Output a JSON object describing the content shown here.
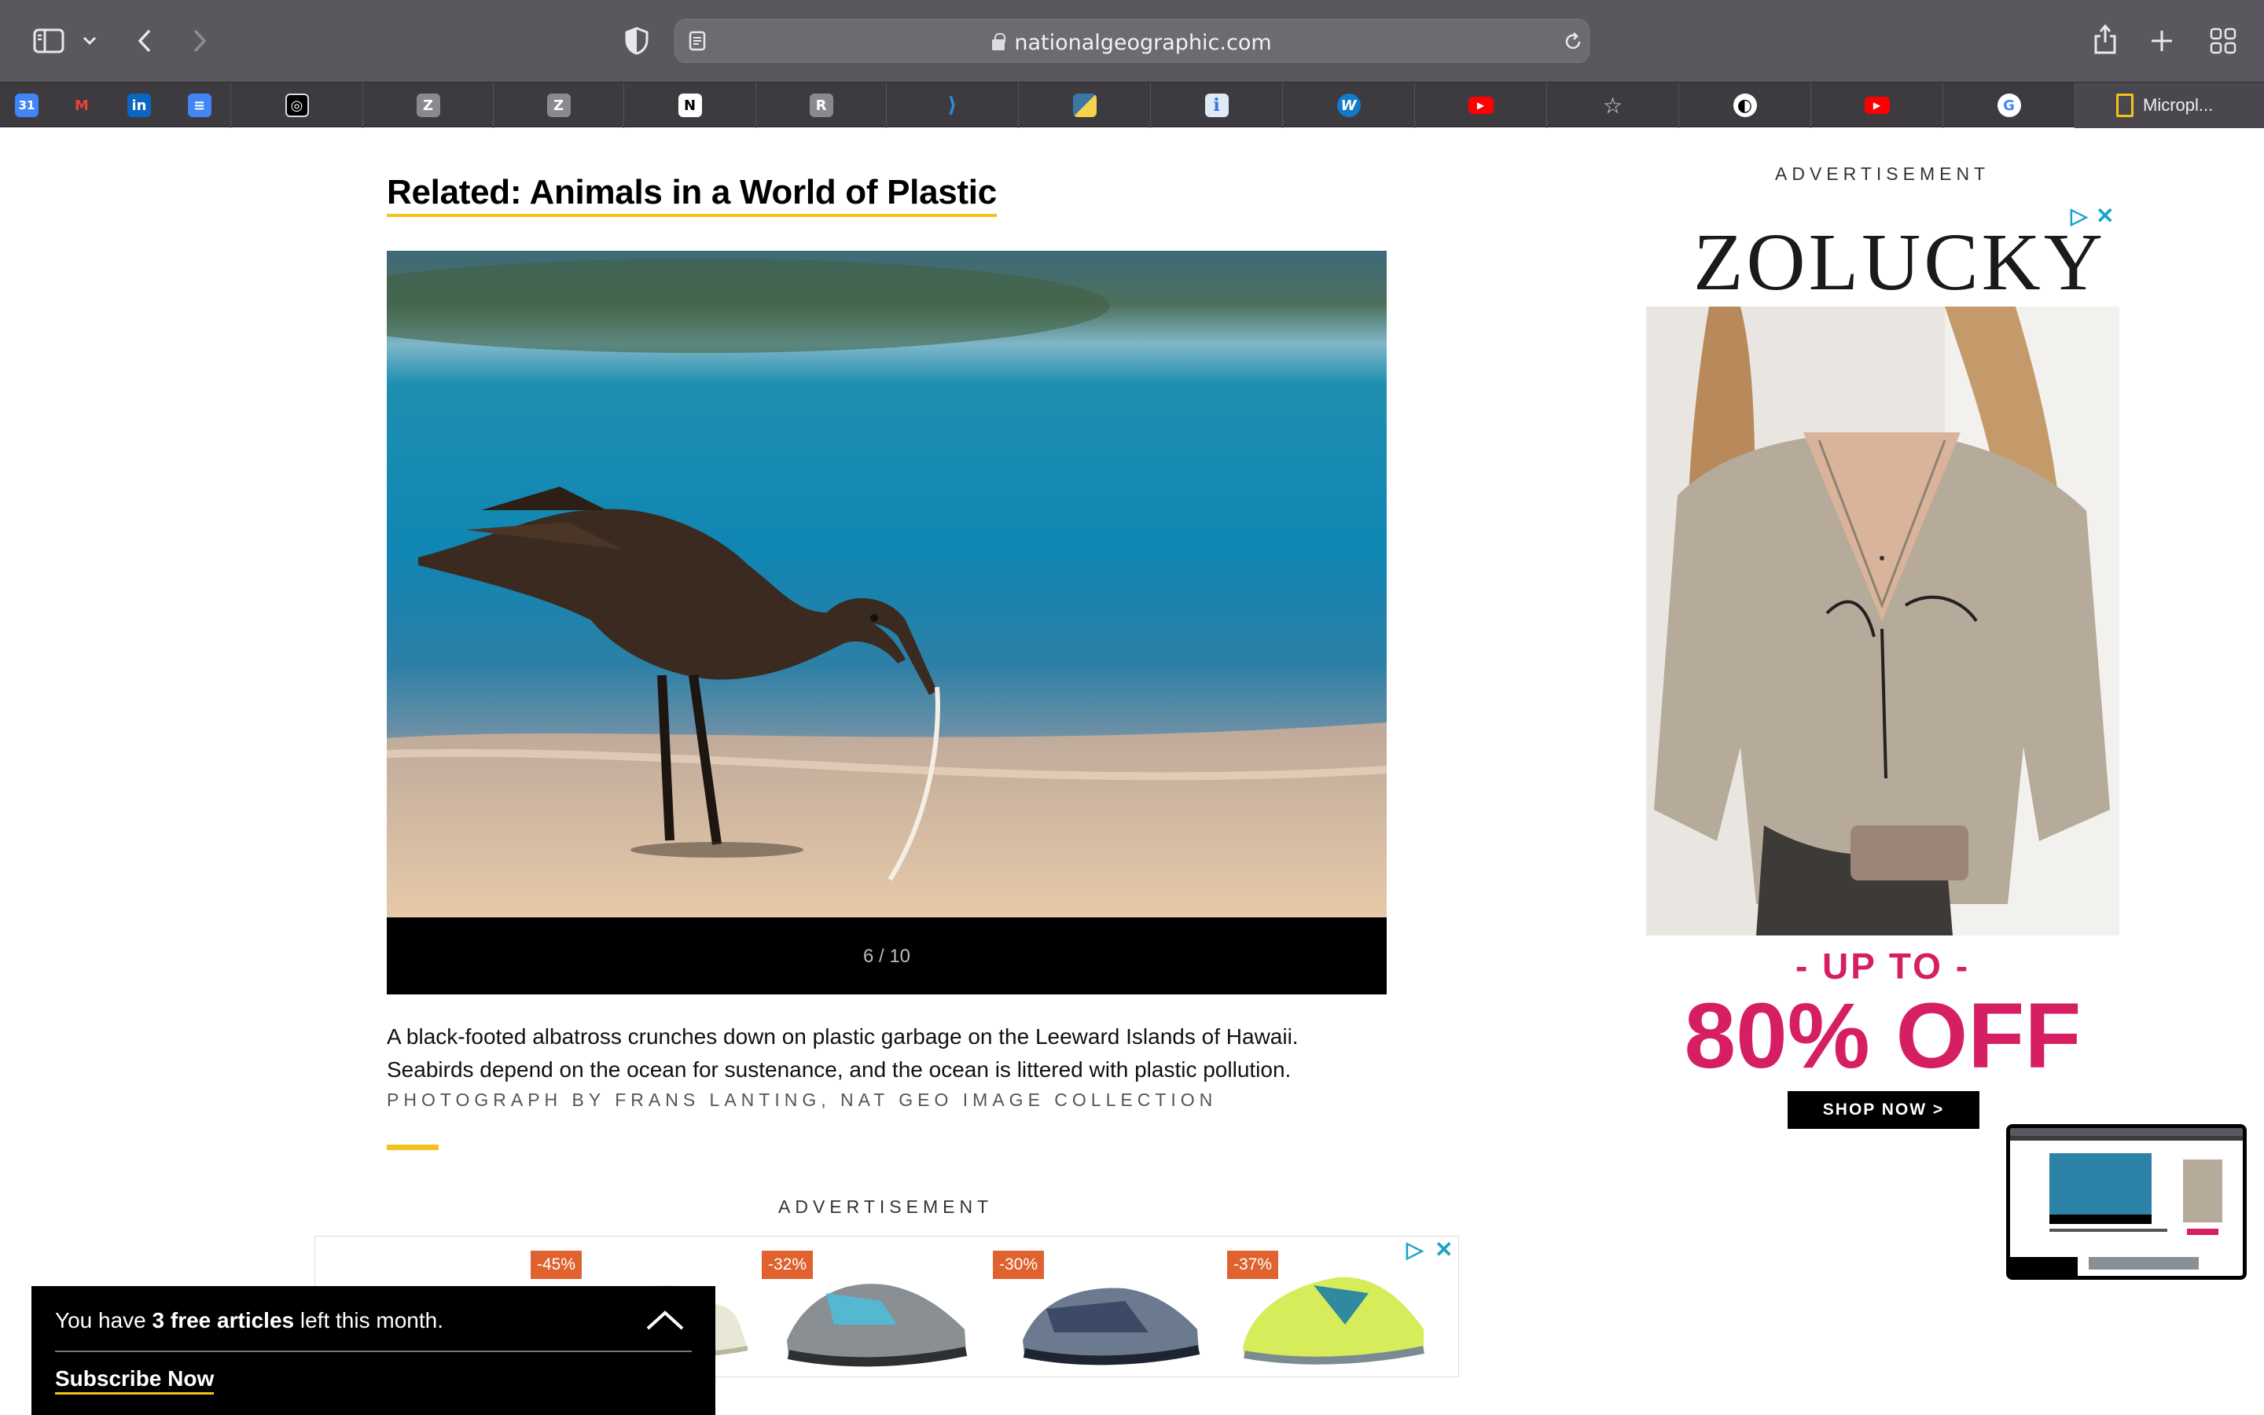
{
  "browser": {
    "url": "nationalgeographic.com",
    "favorites": [
      {
        "icon": "google-calendar-icon",
        "label": "31",
        "color": "#4285f4"
      },
      {
        "icon": "gmail-icon",
        "label": "M",
        "color": "#ea4335"
      },
      {
        "icon": "linkedin-icon",
        "label": "in",
        "color": "#0a66c2"
      },
      {
        "icon": "google-docs-icon",
        "label": "≡",
        "color": "#4285f4"
      },
      {
        "icon": "target-icon",
        "label": "◎",
        "color": "#000000"
      },
      {
        "icon": "zotero-icon",
        "label": "Z",
        "color": "#8a8a8e"
      },
      {
        "icon": "zotero-icon",
        "label": "Z",
        "color": "#8a8a8e"
      },
      {
        "icon": "notion-icon",
        "label": "N",
        "color": "#000000"
      },
      {
        "icon": "r-icon",
        "label": "R",
        "color": "#8a8a8e"
      },
      {
        "icon": "vscode-icon",
        "label": "⟩",
        "color": "#2c8ee0"
      },
      {
        "icon": "python-icon",
        "label": "🐍",
        "color": "#3c75a8"
      },
      {
        "icon": "info-icon",
        "label": "i",
        "color": "#2b78d9"
      },
      {
        "icon": "wordpress-icon",
        "label": "W",
        "color": "#117ac9"
      },
      {
        "icon": "youtube-icon",
        "label": "▶",
        "color": "#ff0000"
      },
      {
        "icon": "star-icon",
        "label": "☆",
        "color": "transparent"
      },
      {
        "icon": "github-icon",
        "label": "◐",
        "color": "#000000"
      },
      {
        "icon": "youtube-icon",
        "label": "▶",
        "color": "#ff0000"
      },
      {
        "icon": "google-icon",
        "label": "G",
        "color": "#ffffff"
      }
    ],
    "last_favorite": {
      "label": "Micropl...",
      "icon": "document-icon"
    }
  },
  "article": {
    "related_title": "Related: Animals in a World of Plastic",
    "slide_counter": "6 / 10",
    "caption_line1": "A black-footed albatross crunches down on plastic garbage on the Leeward Islands of Hawaii.",
    "caption_line2": "Seabirds depend on the ocean for sustenance, and the ocean is littered with plastic pollution.",
    "credit": "Photograph by Frans Lanting, Nat Geo Image Collection",
    "accent_color": "#f5c21b"
  },
  "ads": {
    "label_right": "ADVERTISEMENT",
    "label_bottom": "ADVERTISEMENT",
    "zolucky": {
      "brand": "ZOLUCKY",
      "up_to": "- UP TO -",
      "discount": "80% OFF",
      "cta": "SHOP NOW >"
    },
    "shoes": [
      {
        "discount": "-45%"
      },
      {
        "discount": "-32%"
      },
      {
        "discount": "-30%"
      },
      {
        "discount": "-37%"
      }
    ]
  },
  "paywall": {
    "prefix": "You have ",
    "count": "3 free articles",
    "suffix": " left this month.",
    "cta": "Subscribe Now"
  }
}
